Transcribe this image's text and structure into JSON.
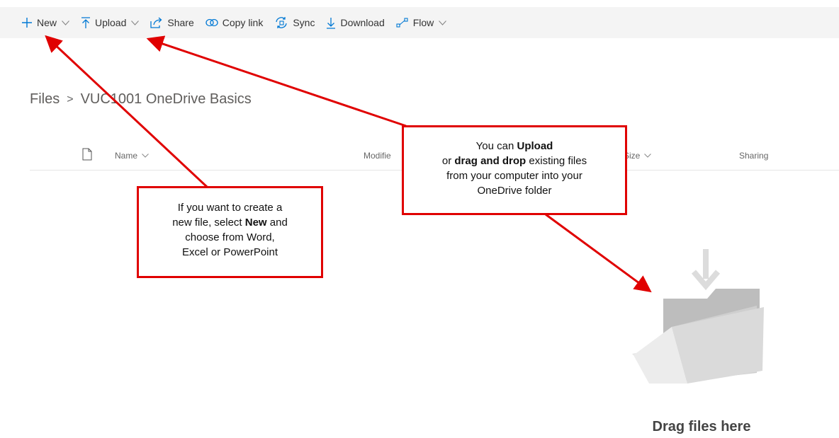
{
  "toolbar": {
    "new_label": "New",
    "upload_label": "Upload",
    "share_label": "Share",
    "copylink_label": "Copy link",
    "sync_label": "Sync",
    "download_label": "Download",
    "flow_label": "Flow"
  },
  "breadcrumb": {
    "root": "Files",
    "separator": ">",
    "current": "VUC1001 OneDrive Basics"
  },
  "columns": {
    "name": "Name",
    "modified": "Modifie",
    "size": "e Size",
    "sharing": "Sharing"
  },
  "callouts": {
    "left": {
      "line1": "If you want to create a",
      "line2_pre": "new file, select ",
      "line2_bold": "New",
      "line2_post": " and",
      "line3": "choose from Word,",
      "line4": "Excel or PowerPoint"
    },
    "right": {
      "line1_pre": "You can ",
      "line1_bold": "Upload",
      "line2_pre": "or ",
      "line2_bold": "drag and drop",
      "line2_post": " existing files",
      "line3": "from your computer into your",
      "line4": "OneDrive folder"
    }
  },
  "empty_state": {
    "text": "Drag files here"
  },
  "colors": {
    "accent": "#0078d4",
    "callout_red": "#e00000",
    "toolbar_bg": "#f4f4f4"
  }
}
